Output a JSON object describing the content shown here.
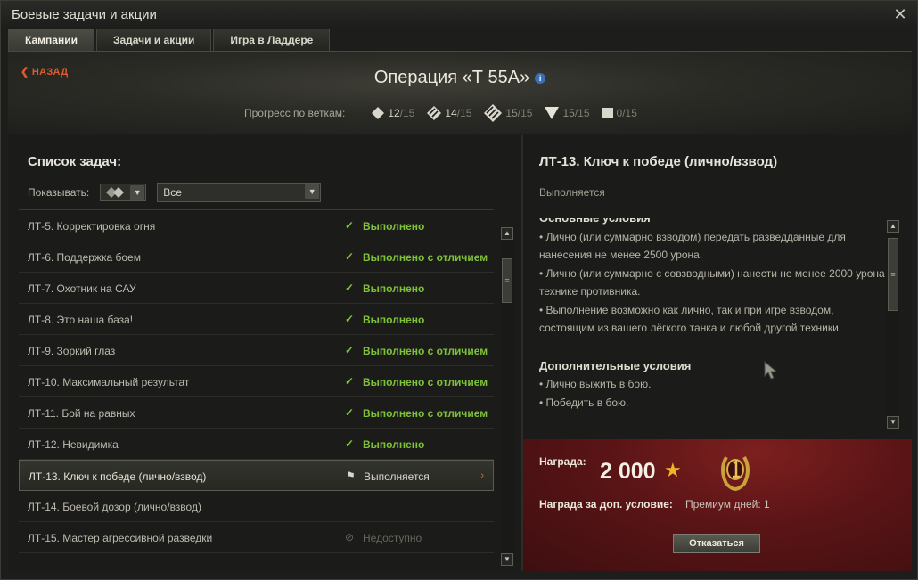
{
  "window": {
    "title": "Боевые задачи и акции"
  },
  "tabs": [
    {
      "label": "Кампании",
      "active": true
    },
    {
      "label": "Задачи и акции",
      "active": false
    },
    {
      "label": "Игра в Ладдере",
      "active": false
    }
  ],
  "header": {
    "back_label": "НАЗАД",
    "operation_title": "Операция «Т 55А»",
    "info_icon": "i",
    "progress_label": "Прогресс по веткам:",
    "branches": [
      {
        "icon": "light-tank-icon",
        "count": "12",
        "total": "/15"
      },
      {
        "icon": "medium-tank-icon",
        "count": "14",
        "total": "/15"
      },
      {
        "icon": "heavy-tank-icon",
        "count": "15",
        "total": "/15"
      },
      {
        "icon": "tank-destroyer-icon",
        "count": "15",
        "total": "/15"
      },
      {
        "icon": "spg-icon",
        "count": "0",
        "total": "/15"
      }
    ]
  },
  "task_list": {
    "title": "Список задач:",
    "filter_label": "Показывать:",
    "filter_value": "Все",
    "rows": [
      {
        "name": "ЛТ-5. Корректировка огня",
        "status": "Выполнено",
        "state": "done"
      },
      {
        "name": "ЛТ-6. Поддержка боем",
        "status": "Выполнено с отличием",
        "state": "done"
      },
      {
        "name": "ЛТ-7. Охотник на САУ",
        "status": "Выполнено",
        "state": "done"
      },
      {
        "name": "ЛТ-8. Это наша база!",
        "status": "Выполнено",
        "state": "done"
      },
      {
        "name": "ЛТ-9. Зоркий глаз",
        "status": "Выполнено с отличием",
        "state": "done"
      },
      {
        "name": "ЛТ-10. Максимальный результат",
        "status": "Выполнено с отличием",
        "state": "done"
      },
      {
        "name": "ЛТ-11. Бой на равных",
        "status": "Выполнено с отличием",
        "state": "done"
      },
      {
        "name": "ЛТ-12. Невидимка",
        "status": "Выполнено",
        "state": "done"
      },
      {
        "name": "ЛТ-13. Ключ к победе (лично/взвод)",
        "status": "Выполняется",
        "state": "progress",
        "selected": true
      },
      {
        "name": "ЛТ-14. Боевой дозор (лично/взвод)",
        "status": "",
        "state": "none"
      },
      {
        "name": "ЛТ-15. Мастер агрессивной разведки",
        "status": "Недоступно",
        "state": "locked"
      }
    ]
  },
  "detail": {
    "title": "ЛТ-13. Ключ к победе (лично/взвод)",
    "status": "Выполняется",
    "main_conditions_title": "Основные условия",
    "main_conditions": [
      "• Лично (или суммарно взводом) передать разведданные для нанесения не менее 2500 урона.",
      "• Лично (или суммарно с совзводными) нанести не менее 2000 урона технике противника.",
      "• Выполнение возможно как лично, так и при игре взводом, состоящим из вашего лёгкого танка и любой другой техники."
    ],
    "extra_conditions_title": "Дополнительные условия",
    "extra_conditions": [
      "• Лично выжить в бою.",
      "• Победить в бою."
    ]
  },
  "reward": {
    "label": "Награда:",
    "value": "2 000",
    "star": "★",
    "extra_label": "Награда за доп. условие:",
    "extra_value": "Премиум дней: 1",
    "decline_label": "Отказаться"
  },
  "colors": {
    "done": "#7fc23a",
    "accent": "#e15a2c",
    "reward_bg": "#5a1416"
  }
}
